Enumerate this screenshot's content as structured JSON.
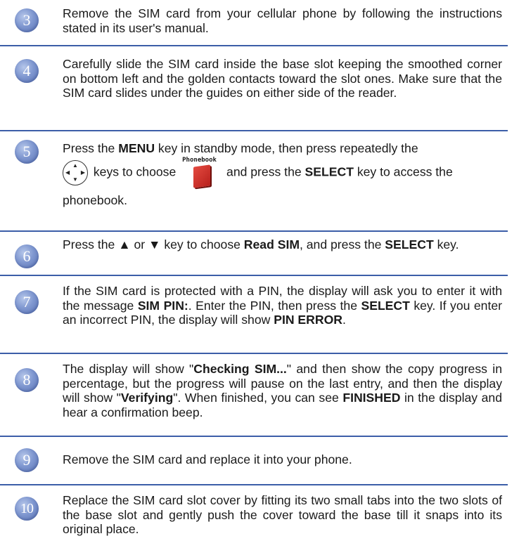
{
  "steps": [
    {
      "number": "3",
      "text": "Remove the SIM card from your cellular phone by following the instructions stated in its user's manual."
    },
    {
      "number": "4",
      "text": "Carefully slide the SIM card inside the base slot keeping the smoothed corner on bottom left and the golden contacts toward the slot ones. Make sure that the SIM card slides under the guides on either side of the reader."
    },
    {
      "number": "5",
      "parts": {
        "a": "Press the ",
        "b1": "MENU",
        "c": " key in standby mode, then press repeatedly the",
        "d": " keys to choose ",
        "icon_label": "Phonebook",
        "e": " and press the ",
        "b2": "SELECT",
        "f": " key to access the",
        "g": "phonebook."
      }
    },
    {
      "number": "6",
      "parts": {
        "a": "Press the ▲ or ▼ key to choose ",
        "b1": "Read SIM",
        "c": ", and press the ",
        "b2": "SELECT",
        "d": " key."
      }
    },
    {
      "number": "7",
      "parts": {
        "a": "If the SIM card is protected with a PIN, the display will ask you to enter it  with the message ",
        "b1": "SIM PIN:",
        "c": ". Enter the PIN, then press the ",
        "b2": "SELECT",
        "d": " key.  If you enter an incorrect PIN, the display will show ",
        "b3": "PIN ERROR",
        "e": "."
      }
    },
    {
      "number": "8",
      "parts": {
        "a": "The display will show \"",
        "b1": "Checking SIM...",
        "c": "\" and then show the copy progress in percentage, but the progress will pause on the last entry, and then the display will show \"",
        "b2": "Verifying",
        "d": "\". When finished, you can see ",
        "b3": "FINISHED",
        "e": " in the display and hear a confirmation beep."
      }
    },
    {
      "number": "9",
      "text": "Remove the SIM card and replace it into your phone."
    },
    {
      "number": "10",
      "text": "Replace the SIM card slot cover by fitting its two small tabs into the two slots of the base slot and gently push the cover toward the base till it snaps into its original place."
    }
  ],
  "icons": {
    "nav": "navigation-keys-icon",
    "phonebook": "phonebook-icon"
  },
  "colors": {
    "badge": "#7f97d0",
    "divider": "#3c5ea8"
  }
}
